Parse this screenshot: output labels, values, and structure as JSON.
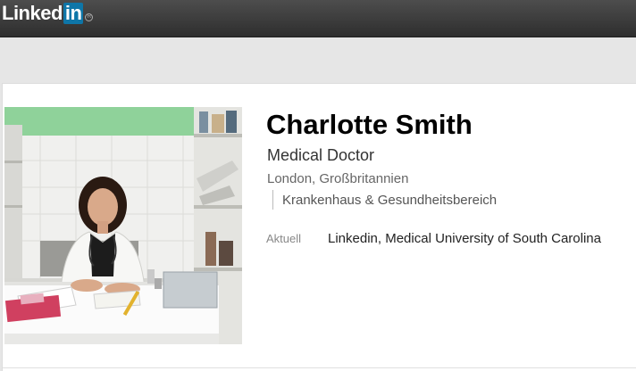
{
  "header": {
    "logo_text": "Linked",
    "logo_box_text": "in",
    "logo_reg": "R"
  },
  "profile": {
    "name": "Charlotte Smith",
    "headline": "Medical Doctor",
    "location": "London, Großbritannien",
    "industry": "Krankenhaus & Gesundheitsbereich",
    "current_label": "Aktuell",
    "current_value": "Linkedin, Medical University of South Carolina"
  },
  "colors": {
    "brand": "#0e76a8",
    "topbar": "#3a3a3a",
    "page_bg": "#e6e6e6"
  }
}
